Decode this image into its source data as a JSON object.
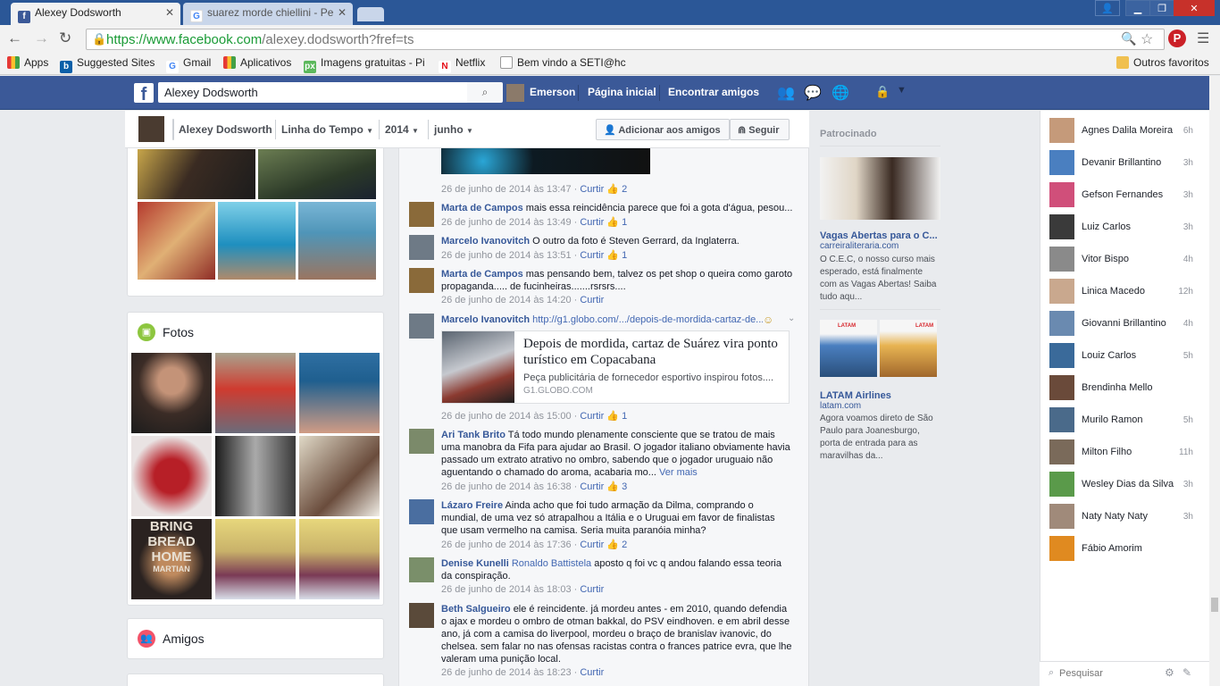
{
  "browser": {
    "tabs": [
      {
        "label": "Alexey Dodsworth",
        "icon": "facebook-icon"
      },
      {
        "label": "suarez morde chiellini - Pe",
        "icon": "google-icon"
      }
    ],
    "url_scheme": "https://www.facebook.com",
    "url_path": "/alexey.dodsworth?fref=ts",
    "bookmarks": [
      {
        "label": "Apps"
      },
      {
        "label": "Suggested Sites"
      },
      {
        "label": "Gmail"
      },
      {
        "label": "Aplicativos"
      },
      {
        "label": "Imagens gratuitas - Pi"
      },
      {
        "label": "Netflix"
      },
      {
        "label": "Bem vindo a SETI@hc"
      }
    ],
    "other_bookmarks": "Outros favoritos"
  },
  "fb_header": {
    "search_value": "Alexey Dodsworth",
    "user": "Emerson",
    "home": "Página inicial",
    "find_friends": "Encontrar amigos"
  },
  "timeline_nav": {
    "name": "Alexey Dodsworth",
    "timeline": "Linha do Tempo",
    "year": "2014",
    "month": "junho",
    "add_friend": "Adicionar aos amigos",
    "follow": "Seguir"
  },
  "left": {
    "photos_title": "Fotos",
    "friends_title": "Amigos",
    "poster_text": [
      "BRING",
      "BREAD",
      "HOME",
      "MARTIAN"
    ]
  },
  "comments": [
    {
      "name": "",
      "text": "",
      "time": "26 de junho de 2014 às 13:47",
      "action": "Curtir",
      "likes": "2"
    },
    {
      "name": "Marta de Campos",
      "text": "mais essa reincidência parece que foi a gota d'água, pesou...",
      "time": "26 de junho de 2014 às 13:49",
      "action": "Curtir",
      "likes": "1"
    },
    {
      "name": "Marcelo Ivanovitch",
      "text": "O outro da foto é Steven Gerrard, da Inglaterra.",
      "time": "26 de junho de 2014 às 13:51",
      "action": "Curtir",
      "likes": "1"
    },
    {
      "name": "Marta de Campos",
      "text": "mas pensando bem, talvez os pet shop o queira como garoto propaganda..... de fucinheiras.......rsrsrs....",
      "time": "26 de junho de 2014 às 14:20",
      "action": "Curtir",
      "likes": ""
    },
    {
      "name": "Marcelo Ivanovitch",
      "text": "http://g1.globo.com/.../depois-de-mordida-cartaz-de...",
      "time": "26 de junho de 2014 às 15:00",
      "action": "Curtir",
      "likes": "1"
    },
    {
      "name": "Ari Tank Brito",
      "text": "Tá todo mundo plenamente consciente que se tratou de mais uma manobra da Fifa para ajudar ao Brasil. O jogador italiano obviamente havia passado um extrato atrativo no ombro, sabendo que o jogador uruguaio não aguentando o chamado do aroma, acabaria mo...",
      "more": "Ver mais",
      "time": "26 de junho de 2014 às 16:38",
      "action": "Curtir",
      "likes": "3"
    },
    {
      "name": "Lázaro Freire",
      "text": "Ainda acho que foi tudo armação da Dilma, comprando o mundial, de uma vez só atrapalhou a Itália e o Uruguai em favor de finalistas que usam vermelho na camisa. Seria muita paranóia minha?",
      "time": "26 de junho de 2014 às 17:36",
      "action": "Curtir",
      "likes": "2"
    },
    {
      "name": "Denise Kunelli",
      "mention": "Ronaldo Battistela",
      "text": "aposto q foi vc q andou falando essa teoria da conspiração.",
      "time": "26 de junho de 2014 às 18:03",
      "action": "Curtir",
      "likes": ""
    },
    {
      "name": "Beth Salgueiro",
      "text": "ele é reincidente. já mordeu antes - em 2010, quando defendia o ajax e mordeu o ombro de otman bakkal, do PSV eindhoven. e em abril desse ano, já com a camisa do liverpool, mordeu o braço de branislav ivanovic, do chelsea. sem falar no nas ofensas racistas contra o frances patrice evra, que lhe valeram uma punição local.",
      "time": "26 de junho de 2014 às 18:23",
      "action": "Curtir",
      "likes": ""
    }
  ],
  "link_preview": {
    "title": "Depois de mordida, cartaz de Suárez vira ponto turístico em Copacabana",
    "desc": "Peça publicitária de fornecedor esportivo inspirou fotos....",
    "domain": "G1.GLOBO.COM"
  },
  "sponsored": {
    "header": "Patrocinado",
    "ads": [
      {
        "title": "Vagas Abertas para o C...",
        "domain": "carreiraliteraria.com",
        "text": "O C.E.C, o nosso curso mais esperado, está finalmente com as Vagas Abertas! Saiba tudo aqu..."
      },
      {
        "title": "LATAM Airlines",
        "domain": "latam.com",
        "text": "Agora voamos direto de São Paulo para Joanesburgo, porta de entrada para as maravilhas da...",
        "img_text": "LATAM"
      }
    ]
  },
  "chat": {
    "friends": [
      {
        "name": "Agnes Dalila Moreira",
        "time": "6h"
      },
      {
        "name": "Devanir Brillantino",
        "time": "3h"
      },
      {
        "name": "Gefson Fernandes",
        "time": "3h"
      },
      {
        "name": "Luiz Carlos",
        "time": "3h"
      },
      {
        "name": "Vitor Bispo",
        "time": "4h"
      },
      {
        "name": "Linica Macedo",
        "time": "12h"
      },
      {
        "name": "Giovanni Brillantino",
        "time": "4h"
      },
      {
        "name": "Louiz Carlos",
        "time": "5h"
      },
      {
        "name": "Brendinha Mello",
        "time": ""
      },
      {
        "name": "Murilo Ramon",
        "time": "5h"
      },
      {
        "name": "Milton Filho",
        "time": "11h"
      },
      {
        "name": "Wesley Dias da Silva",
        "time": "3h"
      },
      {
        "name": "Naty Naty Naty",
        "time": "3h"
      },
      {
        "name": "Fábio Amorim",
        "time": ""
      }
    ],
    "search_placeholder": "Pesquisar"
  },
  "colors": {
    "fb_blue": "#3b5998",
    "link": "#365899",
    "chrome_tab": "#2b5797"
  }
}
